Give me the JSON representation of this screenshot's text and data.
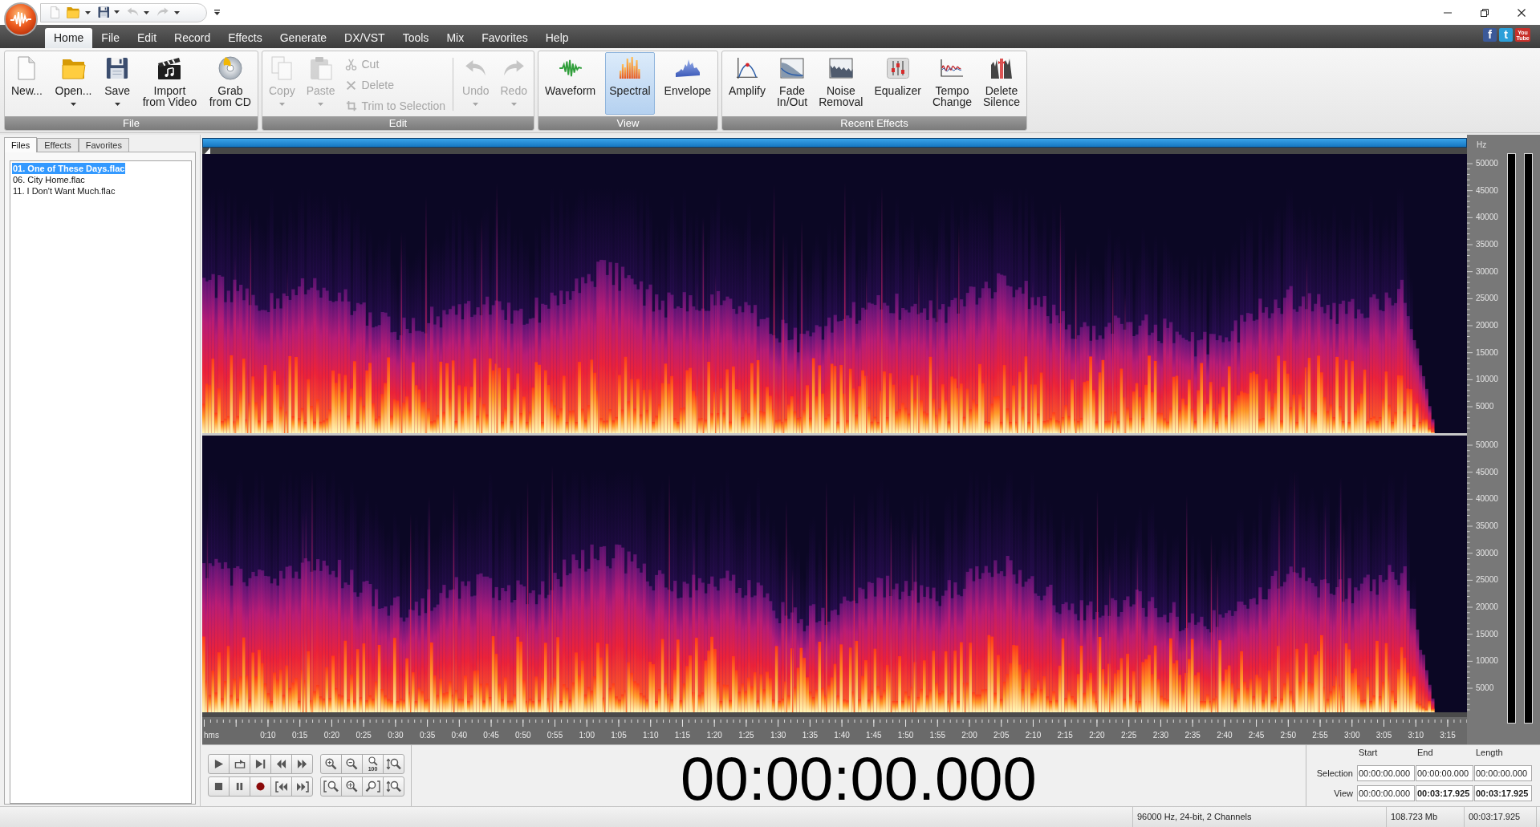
{
  "quick_access_toolbar": [
    {
      "dropdown": false,
      "disabled": false
    },
    {
      "dropdown": true,
      "disabled": false
    },
    {
      "dropdown": true,
      "disabled": false
    },
    {
      "dropdown": true,
      "disabled": true
    },
    {
      "dropdown": true,
      "disabled": true
    }
  ],
  "menu_tabs": [
    {
      "label": "Home",
      "selected": true
    },
    {
      "label": "File",
      "selected": false
    },
    {
      "label": "Edit",
      "selected": false
    },
    {
      "label": "Record",
      "selected": false
    },
    {
      "label": "Effects",
      "selected": false
    },
    {
      "label": "Generate",
      "selected": false
    },
    {
      "label": "DX/VST",
      "selected": false
    },
    {
      "label": "Tools",
      "selected": false
    },
    {
      "label": "Mix",
      "selected": false
    },
    {
      "label": "Favorites",
      "selected": false
    },
    {
      "label": "Help",
      "selected": false
    }
  ],
  "social_links": [
    {
      "kind": "letter",
      "label": "f",
      "color": "#3b5998"
    },
    {
      "kind": "letter",
      "label": "t",
      "color": "#2b9fd9"
    },
    {
      "kind": "wordmark",
      "label": "You\nTube",
      "color": "#c8302a"
    }
  ],
  "ribbon_groups": [
    {
      "label": "File",
      "items": [
        {
          "kind": "large",
          "label": "New...",
          "dropdown": false,
          "disabled": false
        },
        {
          "kind": "large",
          "label": "Open...",
          "dropdown": true,
          "disabled": false
        },
        {
          "kind": "large",
          "label": "Save",
          "dropdown": true,
          "disabled": false
        },
        {
          "kind": "large",
          "label": "Import\nfrom Video",
          "dropdown": false,
          "disabled": false
        },
        {
          "kind": "large",
          "label": "Grab\nfrom CD",
          "dropdown": false,
          "disabled": false
        }
      ]
    },
    {
      "label": "Edit",
      "items": [
        {
          "kind": "large",
          "label": "Copy",
          "dropdown": true,
          "disabled": true
        },
        {
          "kind": "large",
          "label": "Paste",
          "dropdown": true,
          "disabled": true
        },
        {
          "kind": "stack",
          "items": [
            {
              "label": "Cut",
              "disabled": true
            },
            {
              "label": "Delete",
              "disabled": true
            },
            {
              "label": "Trim to Selection",
              "disabled": true
            }
          ]
        },
        {
          "kind": "separator"
        },
        {
          "kind": "large",
          "label": "Undo",
          "dropdown": true,
          "disabled": true
        },
        {
          "kind": "large",
          "label": "Redo",
          "dropdown": true,
          "disabled": true
        }
      ]
    },
    {
      "label": "View",
      "items": [
        {
          "kind": "large",
          "label": "Waveform",
          "selected": false
        },
        {
          "kind": "large",
          "label": "Spectral",
          "selected": true
        },
        {
          "kind": "large",
          "label": "Envelope",
          "selected": false
        }
      ]
    },
    {
      "label": "Recent Effects",
      "items": [
        {
          "kind": "large",
          "label": "Amplify"
        },
        {
          "kind": "large",
          "label": "Fade\nIn/Out"
        },
        {
          "kind": "large",
          "label": "Noise\nRemoval"
        },
        {
          "kind": "large",
          "label": "Equalizer"
        },
        {
          "kind": "large",
          "label": "Tempo\nChange"
        },
        {
          "kind": "large",
          "label": "Delete\nSilence"
        }
      ]
    }
  ],
  "side_panel": {
    "tabs": [
      {
        "label": "Files",
        "selected": true
      },
      {
        "label": "Effects",
        "selected": false
      },
      {
        "label": "Favorites",
        "selected": false
      }
    ],
    "files": [
      {
        "name": "01. One of These Days.flac",
        "selected": true
      },
      {
        "name": "06. City Home.flac",
        "selected": false
      },
      {
        "name": "11. I Don't Want Much.flac",
        "selected": false
      }
    ]
  },
  "editor": {
    "frequency_axis": {
      "unit": "Hz",
      "channels": [
        {
          "labels": [
            "50000",
            "45000",
            "40000",
            "35000",
            "30000",
            "25000",
            "20000",
            "15000",
            "10000",
            "5000"
          ]
        },
        {
          "labels": [
            "50000",
            "45000",
            "40000",
            "35000",
            "30000",
            "25000",
            "20000",
            "15000",
            "10000",
            "5000"
          ]
        }
      ]
    },
    "time_ruler": {
      "unit": "hms",
      "labels": [
        "0:10",
        "0:15",
        "0:20",
        "0:25",
        "0:30",
        "0:35",
        "0:40",
        "0:45",
        "0:50",
        "0:55",
        "1:00",
        "1:05",
        "1:10",
        "1:15",
        "1:20",
        "1:25",
        "1:30",
        "1:35",
        "1:40",
        "1:45",
        "1:50",
        "1:55",
        "2:00",
        "2:05",
        "2:10",
        "2:15",
        "2:20",
        "2:25",
        "2:30",
        "2:35",
        "2:40",
        "2:45",
        "2:50",
        "2:55",
        "3:00",
        "3:05",
        "3:10",
        "3:15"
      ]
    }
  },
  "transport": {
    "zoom_level_label": "100"
  },
  "time_display": "00:00:00.000",
  "range_panel": {
    "columns": [
      "Start",
      "End",
      "Length"
    ],
    "rows": [
      {
        "label": "Selection",
        "values": [
          {
            "text": "00:00:00.000",
            "bold": false
          },
          {
            "text": "00:00:00.000",
            "bold": false
          },
          {
            "text": "00:00:00.000",
            "bold": false
          }
        ]
      },
      {
        "label": "View",
        "values": [
          {
            "text": "00:00:00.000",
            "bold": false
          },
          {
            "text": "00:03:17.925",
            "bold": true
          },
          {
            "text": "00:03:17.925",
            "bold": true
          }
        ]
      }
    ]
  },
  "status_bar": [
    "96000 Hz, 24-bit, 2 Channels",
    "108.723 Mb",
    "00:03:17.925"
  ]
}
